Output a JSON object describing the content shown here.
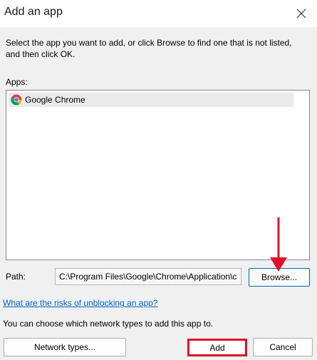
{
  "window": {
    "title": "Add an app"
  },
  "instructions": "Select the app you want to add, or click Browse to find one that is not listed, and then click OK.",
  "apps": {
    "label": "Apps:",
    "items": [
      {
        "name": "Google Chrome",
        "icon": "chrome-icon"
      }
    ]
  },
  "path": {
    "label": "Path:",
    "value": "C:\\Program Files\\Google\\Chrome\\Application\\chrome.exe"
  },
  "buttons": {
    "browse": "Browse...",
    "network_types": "Network types...",
    "add": "Add",
    "cancel": "Cancel"
  },
  "risks_link": "What are the risks of unblocking an app?",
  "network_note": "You can choose which network types to add this app to.",
  "colors": {
    "link": "#0066cc",
    "highlight": "#e0102a",
    "focus_border": "#0067c0"
  }
}
